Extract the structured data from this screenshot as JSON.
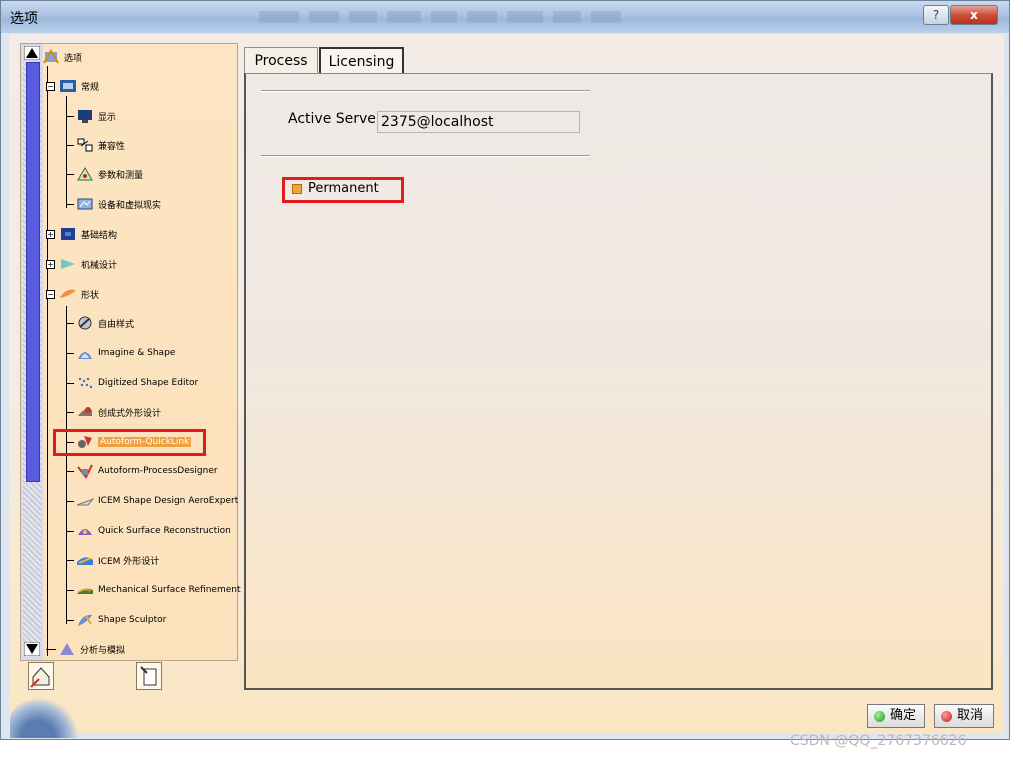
{
  "window": {
    "title": "选项"
  },
  "title_buttons": {
    "help": "?",
    "close": "x"
  },
  "tree": {
    "root": "选项",
    "items": [
      {
        "label": "常规",
        "icon": "general-icon"
      },
      {
        "label": "显示",
        "icon": "display-icon"
      },
      {
        "label": "兼容性",
        "icon": "compatibility-icon"
      },
      {
        "label": "参数和测量",
        "icon": "parameters-icon"
      },
      {
        "label": "设备和虚拟现实",
        "icon": "devices-icon"
      },
      {
        "label": "基础结构",
        "icon": "infrastructure-icon"
      },
      {
        "label": "机械设计",
        "icon": "mechanical-icon"
      },
      {
        "label": "形状",
        "icon": "shape-icon"
      },
      {
        "label": "自由样式",
        "icon": "freestyle-icon"
      },
      {
        "label": "Imagine & Shape",
        "icon": "imagine-shape-icon"
      },
      {
        "label": "Digitized Shape Editor",
        "icon": "digitized-shape-icon"
      },
      {
        "label": "创成式外形设计",
        "icon": "generative-shape-icon"
      },
      {
        "label": "Autoform-QuickLink",
        "icon": "autoform-quicklink-icon"
      },
      {
        "label": "Autoform-ProcessDesigner",
        "icon": "autoform-process-icon"
      },
      {
        "label": "ICEM Shape Design AeroExpert",
        "icon": "icem-aero-icon"
      },
      {
        "label": "Quick Surface Reconstruction",
        "icon": "quick-surface-icon"
      },
      {
        "label": "ICEM 外形设计",
        "icon": "icem-shape-icon"
      },
      {
        "label": "Mechanical Surface Refinement",
        "icon": "surface-refinement-icon"
      },
      {
        "label": "Shape Sculptor",
        "icon": "shape-sculptor-icon"
      },
      {
        "label": "分析与模拟",
        "icon": "analysis-icon"
      }
    ]
  },
  "tabs": [
    {
      "label": "Process"
    },
    {
      "label": "Licensing"
    }
  ],
  "licensing": {
    "active_server_label": "Active Server",
    "active_server_value": "2375@localhost",
    "permanent_label": "Permanent"
  },
  "buttons": {
    "ok": "确定",
    "cancel": "取消"
  },
  "watermark": "CSDN @QQ_2767376626"
}
